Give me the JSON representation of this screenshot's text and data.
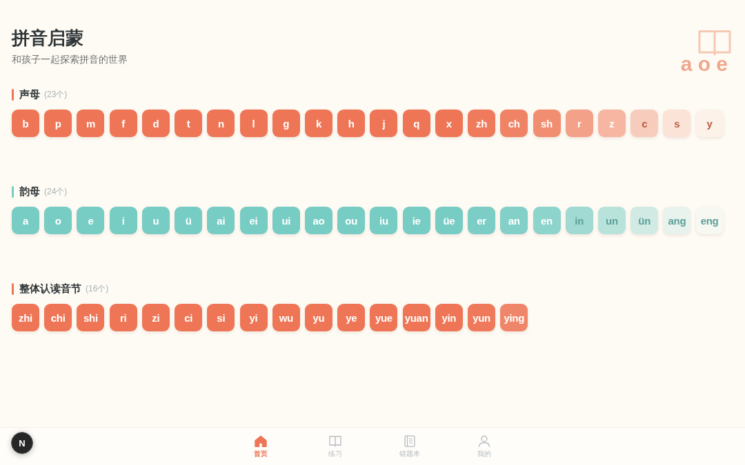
{
  "header": {
    "title": "拼音启蒙",
    "subtitle": "和孩子一起探索拼音的世界",
    "decoration": "a o e"
  },
  "sections": [
    {
      "title": "声母",
      "count": "(23个)",
      "color": "#ee7656",
      "tiles": [
        {
          "label": "b",
          "color": "#ee7656"
        },
        {
          "label": "p",
          "color": "#ee7656"
        },
        {
          "label": "m",
          "color": "#ee7656"
        },
        {
          "label": "f",
          "color": "#ee7656"
        },
        {
          "label": "d",
          "color": "#ee7656"
        },
        {
          "label": "t",
          "color": "#ee7656"
        },
        {
          "label": "n",
          "color": "#ee7656"
        },
        {
          "label": "l",
          "color": "#ee7656"
        },
        {
          "label": "g",
          "color": "#ee7656"
        },
        {
          "label": "k",
          "color": "#ee7656"
        },
        {
          "label": "h",
          "color": "#ee7656"
        },
        {
          "label": "j",
          "color": "#ee7656"
        },
        {
          "label": "q",
          "color": "#ee7656"
        },
        {
          "label": "x",
          "color": "#ee7656"
        },
        {
          "label": "zh",
          "color": "#ef7b5c"
        },
        {
          "label": "ch",
          "color": "#f08366"
        },
        {
          "label": "sh",
          "color": "#f18e72"
        },
        {
          "label": "r",
          "color": "#f3a189"
        },
        {
          "label": "z",
          "color": "#f6b6a2"
        },
        {
          "label": "c",
          "color": "#f8ccbd"
        },
        {
          "label": "s",
          "color": "#fbe3d8"
        },
        {
          "label": "y",
          "color": "#fdf2e9"
        }
      ]
    },
    {
      "title": "韵母",
      "count": "(24个)",
      "color": "#77ccc4",
      "tiles": [
        {
          "label": "a",
          "color": "#77ccc4"
        },
        {
          "label": "o",
          "color": "#77ccc4"
        },
        {
          "label": "e",
          "color": "#77ccc4"
        },
        {
          "label": "i",
          "color": "#77ccc4"
        },
        {
          "label": "u",
          "color": "#77ccc4"
        },
        {
          "label": "ü",
          "color": "#77ccc4"
        },
        {
          "label": "ai",
          "color": "#77ccc4"
        },
        {
          "label": "ei",
          "color": "#77ccc4"
        },
        {
          "label": "ui",
          "color": "#77ccc4"
        },
        {
          "label": "ao",
          "color": "#77ccc4"
        },
        {
          "label": "ou",
          "color": "#77ccc4"
        },
        {
          "label": "iu",
          "color": "#77ccc4"
        },
        {
          "label": "ie",
          "color": "#77ccc4"
        },
        {
          "label": "üe",
          "color": "#77ccc4"
        },
        {
          "label": "er",
          "color": "#7bcdc5"
        },
        {
          "label": "an",
          "color": "#82d0c8"
        },
        {
          "label": "en",
          "color": "#8dd4cc"
        },
        {
          "label": "in",
          "color": "#a0dad2"
        },
        {
          "label": "un",
          "color": "#b8e3db"
        },
        {
          "label": "ün",
          "color": "#d1ebe4"
        },
        {
          "label": "ang",
          "color": "#e7f3ec"
        },
        {
          "label": "eng",
          "color": "#f6f8f1"
        }
      ]
    },
    {
      "title": "整体认读音节",
      "count": "(16个)",
      "color": "#ee7656",
      "tiles": [
        {
          "label": "zhi",
          "color": "#ee7656"
        },
        {
          "label": "chi",
          "color": "#ee7656"
        },
        {
          "label": "shi",
          "color": "#ee7656"
        },
        {
          "label": "ri",
          "color": "#ee7656"
        },
        {
          "label": "zi",
          "color": "#ee7656"
        },
        {
          "label": "ci",
          "color": "#ee7656"
        },
        {
          "label": "si",
          "color": "#ee7656"
        },
        {
          "label": "yi",
          "color": "#ee7656"
        },
        {
          "label": "wu",
          "color": "#ee7656"
        },
        {
          "label": "yu",
          "color": "#ee7656"
        },
        {
          "label": "ye",
          "color": "#ee7656"
        },
        {
          "label": "yue",
          "color": "#ee7656"
        },
        {
          "label": "yuan",
          "color": "#ee7656"
        },
        {
          "label": "yin",
          "color": "#ee7656"
        },
        {
          "label": "yun",
          "color": "#ef7a5b"
        },
        {
          "label": "ying",
          "color": "#f08669"
        }
      ]
    }
  ],
  "nav": [
    {
      "label": "首页",
      "kind": "house",
      "selected": true
    },
    {
      "label": "练习",
      "kind": "book",
      "selected": false
    },
    {
      "label": "错题本",
      "kind": "notebook",
      "selected": false
    },
    {
      "label": "我的",
      "kind": "person",
      "selected": false
    }
  ],
  "dev_badge": {
    "label": "N"
  }
}
